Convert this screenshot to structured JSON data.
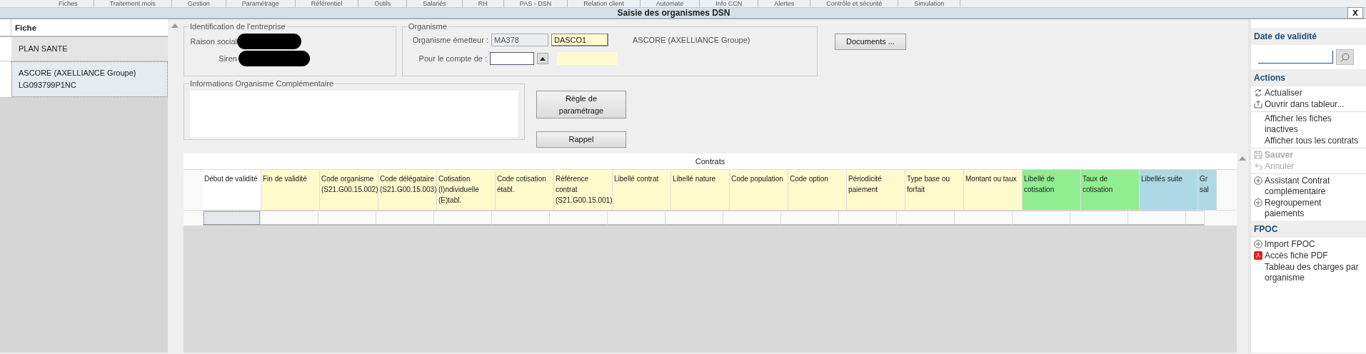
{
  "menu": [
    "Fiches",
    "Traitement mois",
    "Gestion",
    "Paramétrage",
    "Référentiel",
    "Outils",
    "Salariés",
    "RH",
    "PAS - DSN",
    "Relation client",
    "Automate",
    "Info CCN",
    "Alertes",
    "Contrôle et sécurité",
    "Simulation"
  ],
  "window": {
    "title": "Saisie des organismes DSN",
    "close": "X"
  },
  "list": {
    "header": "Fiche",
    "rows": [
      {
        "lines": [
          "PLAN SANTE"
        ],
        "selected": false
      },
      {
        "lines": [
          "ASCORE (AXELLIANCE Groupe)",
          "LG093799P1NC"
        ],
        "selected": true
      }
    ]
  },
  "identification": {
    "legend": "Identification de l'entreprise",
    "fields": [
      {
        "label": "Raison social"
      },
      {
        "label": "Siren"
      }
    ]
  },
  "organisme": {
    "legend": "Organisme",
    "emitter": {
      "label": "Organisme émetteur :",
      "code": "MA378",
      "value": "DASCO1",
      "name": "ASCORE (AXELLIANCE Groupe)"
    },
    "account": {
      "label": "Pour le compte de :"
    }
  },
  "documents_button": "Documents ...",
  "info": {
    "legend": "Informations Organisme Complémentaire"
  },
  "buttons": [
    "Règle de paramétrage",
    "Rappel"
  ],
  "contracts": {
    "title": "Contrats",
    "columns": [
      {
        "label": "Début de validité",
        "color": "#ffffff"
      },
      {
        "label": "Fin de validité",
        "color": "#fff9cc"
      },
      {
        "label": "Code organisme (S21.G00.15.002)",
        "color": "#fff9cc"
      },
      {
        "label": "Code délégataire (S21.G00.15.003)",
        "color": "#fff9cc"
      },
      {
        "label": "Cotisation (I)ndividuelle (E)tabl.",
        "color": "#fff9cc"
      },
      {
        "label": "Code cotisation établ.",
        "color": "#fff9cc"
      },
      {
        "label": "Référence contrat (S21.G00.15.001)",
        "color": "#fff9cc"
      },
      {
        "label": "Libellé contrat",
        "color": "#fff9cc"
      },
      {
        "label": "Libellé nature",
        "color": "#fff9cc"
      },
      {
        "label": "Code population",
        "color": "#fff9cc"
      },
      {
        "label": "Code option",
        "color": "#fff9cc"
      },
      {
        "label": "Périodicité paiement",
        "color": "#fff9cc"
      },
      {
        "label": "Type base ou forfait",
        "color": "#fff9cc"
      },
      {
        "label": "Montant ou taux",
        "color": "#fff9cc"
      },
      {
        "label": "Libellé de cotisation",
        "color": "#90ee90"
      },
      {
        "label": "Taux de cotisation",
        "color": "#90ee90"
      },
      {
        "label": "Libellés suite",
        "color": "#add8e6"
      },
      {
        "label": "Gr sal",
        "color": "#add8e6"
      }
    ]
  },
  "side": {
    "date_title": "Date de validité",
    "sections": [
      {
        "title": "Actions",
        "groups": [
          [
            {
              "label": "Actualiser",
              "kind": "refresh",
              "disabled": false
            },
            {
              "label": "Ouvrir dans tableur...",
              "kind": "export",
              "disabled": false
            }
          ],
          [
            {
              "label": "Afficher les fiches inactives",
              "kind": "plain",
              "disabled": false
            },
            {
              "label": "Afficher tous les contrats",
              "kind": "plain",
              "disabled": false
            }
          ],
          [
            {
              "label": "Sauver",
              "kind": "save",
              "disabled": true
            },
            {
              "label": "Annuler",
              "kind": "undo",
              "disabled": true
            }
          ],
          [
            {
              "label": "Assistant Contrat complémentaire",
              "kind": "add",
              "disabled": false
            },
            {
              "label": "Regroupement paiements",
              "kind": "add",
              "disabled": false
            }
          ]
        ]
      },
      {
        "title": "FPOC",
        "groups": [
          [
            {
              "label": "Import FPOC",
              "kind": "add",
              "disabled": false
            },
            {
              "label": "Accès fiche PDF",
              "kind": "pdf",
              "disabled": false
            },
            {
              "label": "Tableau des charges par organisme",
              "kind": "plain",
              "disabled": false
            }
          ]
        ]
      }
    ]
  }
}
